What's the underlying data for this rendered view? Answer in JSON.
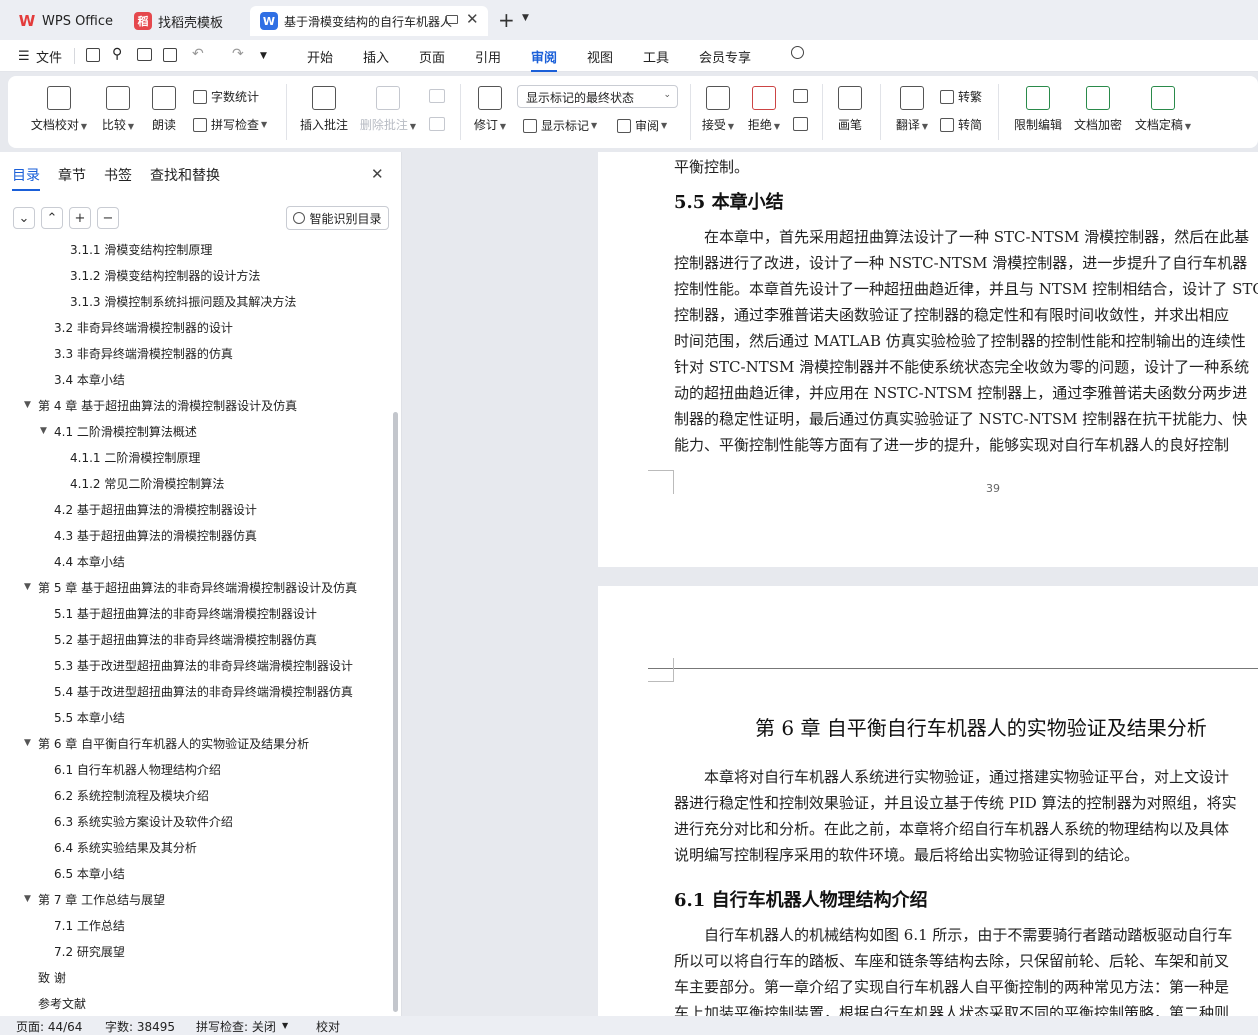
{
  "tabs": [
    {
      "label": "WPS Office",
      "logo": "W",
      "color": "#e33b3b"
    },
    {
      "label": "找稻壳模板",
      "logo": "稻",
      "color": "#e5484d"
    },
    {
      "label": "基于滑模变结构的自行车机器人",
      "logo": "W",
      "color": "#2f6fe4"
    }
  ],
  "menu": {
    "file": "文件",
    "items": [
      "开始",
      "插入",
      "页面",
      "引用",
      "审阅",
      "视图",
      "工具",
      "会员专享"
    ],
    "active": "审阅"
  },
  "ribbon": {
    "doc_check": "文档校对",
    "compare": "比较",
    "read_aloud": "朗读",
    "word_count": "字数统计",
    "spell_check": "拼写检查",
    "insert_comment": "插入批注",
    "delete_comment": "删除批注",
    "revise": "修订",
    "show_mode": "显示标记的最终状态",
    "show_marks": "显示标记",
    "review": "审阅",
    "accept": "接受",
    "reject": "拒绝",
    "pen": "画笔",
    "translate": "翻译",
    "trad": "转繁",
    "simp": "转简",
    "restrict": "限制编辑",
    "encrypt": "文档加密",
    "finalize": "文档定稿"
  },
  "sidebar": {
    "tabs": [
      "目录",
      "章节",
      "书签",
      "查找和替换"
    ],
    "smart_btn": "智能识别目录",
    "items": [
      {
        "text": "3.1.1  滑模变结构控制原理",
        "level": 3
      },
      {
        "text": "3.1.2  滑模变结构控制器的设计方法",
        "level": 3
      },
      {
        "text": "3.1.3  滑模控制系统抖振问题及其解决方法",
        "level": 3
      },
      {
        "text": "3.2  非奇异终端滑模控制器的设计",
        "level": 2
      },
      {
        "text": "3.3  非奇异终端滑模控制器的仿真",
        "level": 2
      },
      {
        "text": "3.4  本章小结",
        "level": 2
      },
      {
        "text": "第 4 章  基于超扭曲算法的滑模控制器设计及仿真",
        "level": 1,
        "open": true
      },
      {
        "text": "4.1  二阶滑模控制算法概述",
        "level": 2,
        "open": true
      },
      {
        "text": "4.1.1  二阶滑模控制原理",
        "level": 3
      },
      {
        "text": "4.1.2  常见二阶滑模控制算法",
        "level": 3
      },
      {
        "text": "4.2  基于超扭曲算法的滑模控制器设计",
        "level": 2
      },
      {
        "text": "4.3  基于超扭曲算法的滑模控制器仿真",
        "level": 2
      },
      {
        "text": "4.4  本章小结",
        "level": 2
      },
      {
        "text": "第 5 章  基于超扭曲算法的非奇异终端滑模控制器设计及仿真",
        "level": 1,
        "open": true
      },
      {
        "text": "5.1  基于超扭曲算法的非奇异终端滑模控制器设计",
        "level": 2
      },
      {
        "text": "5.2  基于超扭曲算法的非奇异终端滑模控制器仿真",
        "level": 2
      },
      {
        "text": "5.3  基于改进型超扭曲算法的非奇异终端滑模控制器设计",
        "level": 2
      },
      {
        "text": "5.4  基于改进型超扭曲算法的非奇异终端滑模控制器仿真",
        "level": 2
      },
      {
        "text": "5.5  本章小结",
        "level": 2
      },
      {
        "text": "第 6 章  自平衡自行车机器人的实物验证及结果分析",
        "level": 1,
        "open": true
      },
      {
        "text": "6.1  自行车机器人物理结构介绍",
        "level": 2
      },
      {
        "text": "6.2  系统控制流程及模块介绍",
        "level": 2
      },
      {
        "text": "6.3  系统实验方案设计及软件介绍",
        "level": 2
      },
      {
        "text": "6.4  系统实验结果及其分析",
        "level": 2
      },
      {
        "text": "6.5  本章小结",
        "level": 2
      },
      {
        "text": "第 7 章  工作总结与展望",
        "level": 1,
        "open": true
      },
      {
        "text": "7.1  工作总结",
        "level": 2
      },
      {
        "text": "7.2  研究展望",
        "level": 2
      },
      {
        "text": "致    谢",
        "level": 1
      },
      {
        "text": "参考文献",
        "level": 1
      }
    ]
  },
  "doc": {
    "top_line": "平衡控制。",
    "h55": "5.5  本章小结",
    "p55": [
      "在本章中，首先采用超扭曲算法设计了一种 STC-NTSM 滑模控制器，然后在此基",
      "控制器进行了改进，设计了一种 NSTC-NTSM 滑模控制器，进一步提升了自行车机器",
      "控制性能。本章首先设计了一种超扭曲趋近律，并且与 NTSM 控制相结合，设计了 STC",
      "控制器，通过李雅普诺夫函数验证了控制器的稳定性和有限时间收敛性，并求出相应",
      "时间范围，然后通过 MATLAB 仿真实验检验了控制器的控制性能和控制输出的连续性",
      "针对 STC-NTSM 滑模控制器并不能使系统状态完全收敛为零的问题，设计了一种系统",
      "动的超扭曲趋近律，并应用在 NSTC-NTSM 控制器上，通过李雅普诺夫函数分两步进",
      "制器的稳定性证明，最后通过仿真实验验证了 NSTC-NTSM 控制器在抗干扰能力、快",
      "能力、平衡控制性能等方面有了进一步的提升，能够实现对自行车机器人的良好控制"
    ],
    "page_no": "39",
    "ch6": "第 6 章  自平衡自行车机器人的实物验证及结果分析",
    "p6": [
      "本章将对自行车机器人系统进行实物验证，通过搭建实物验证平台，对上文设计",
      "器进行稳定性和控制效果验证，并且设立基于传统 PID 算法的控制器为对照组，将实",
      "进行充分对比和分析。在此之前，本章将介绍自行车机器人系统的物理结构以及具体",
      "说明编写控制程序采用的软件环境。最后将给出实物验证得到的结论。"
    ],
    "h61": "6.1  自行车机器人物理结构介绍",
    "p61": [
      "自行车机器人的机械结构如图 6.1 所示，由于不需要骑行者踏动踏板驱动自行车",
      "所以可以将自行车的踏板、车座和链条等结构去除，只保留前轮、后轮、车架和前叉",
      "车主要部分。第一章介绍了实现自行车机器人自平衡控制的两种常见方法：第一种是",
      "车上加装平衡控制装置，根据自行车机器人状态采取不同的平衡控制策略，第二种则"
    ]
  },
  "status": {
    "page": "页面: 44/64",
    "words": "字数: 38495",
    "spell": "拼写检查: 关闭",
    "proof": "校对"
  }
}
